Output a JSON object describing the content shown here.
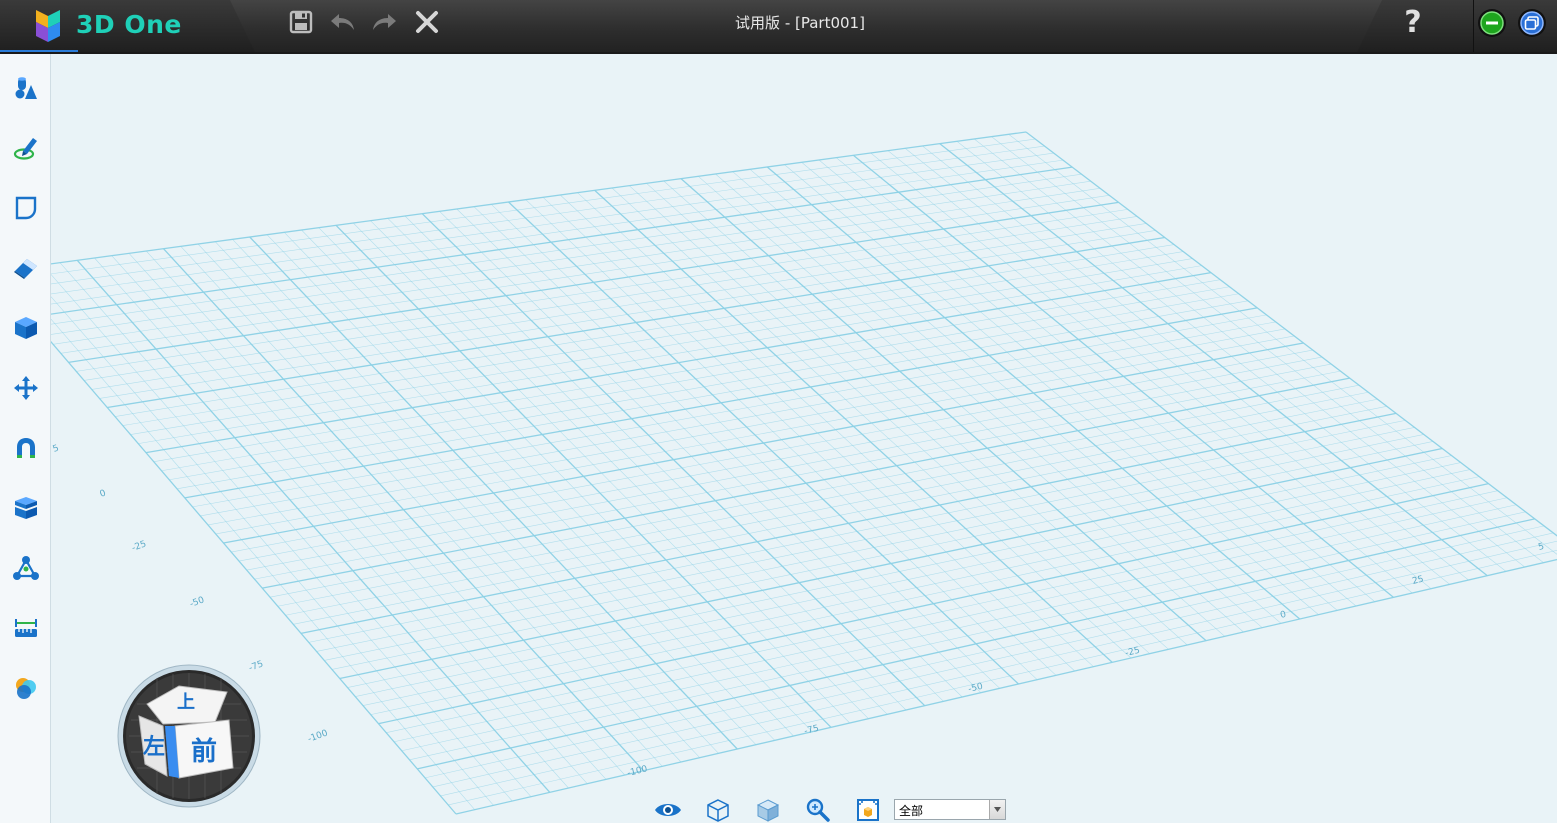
{
  "app": {
    "logo_text": "3D One",
    "document_title": "试用版 - [Part001]"
  },
  "toolbar": {
    "save_icon": "save-icon",
    "undo_icon": "undo-icon",
    "redo_icon": "redo-icon",
    "close_icon": "close-icon",
    "help_label": "?"
  },
  "window_controls": {
    "minimize_color": "#1ea51e",
    "restore_color": "#2a6fd6"
  },
  "left_tools": [
    {
      "name": "basic-shapes-icon"
    },
    {
      "name": "sketch-icon"
    },
    {
      "name": "sketch-edit-icon"
    },
    {
      "name": "feature-eraser-icon"
    },
    {
      "name": "solid-cube-icon"
    },
    {
      "name": "move-icon"
    },
    {
      "name": "magnet-icon"
    },
    {
      "name": "combine-blocks-icon"
    },
    {
      "name": "network-nodes-icon"
    },
    {
      "name": "measure-icon"
    },
    {
      "name": "color-palette-icon"
    }
  ],
  "grid": {
    "labels_left": [
      "5",
      "0",
      "-25",
      "-50",
      "-75",
      "-100"
    ],
    "labels_bottom": [
      "-100",
      "-75",
      "-50",
      "-25",
      "0",
      "25",
      "5"
    ]
  },
  "view_cube": {
    "top": "上",
    "left": "左",
    "front": "前"
  },
  "bottom_toolbar": {
    "filter_value": "全部"
  },
  "colors": {
    "accent": "#1fd0b8",
    "grid": "#8cd1e6",
    "icon_blue": "#1a73c9"
  }
}
